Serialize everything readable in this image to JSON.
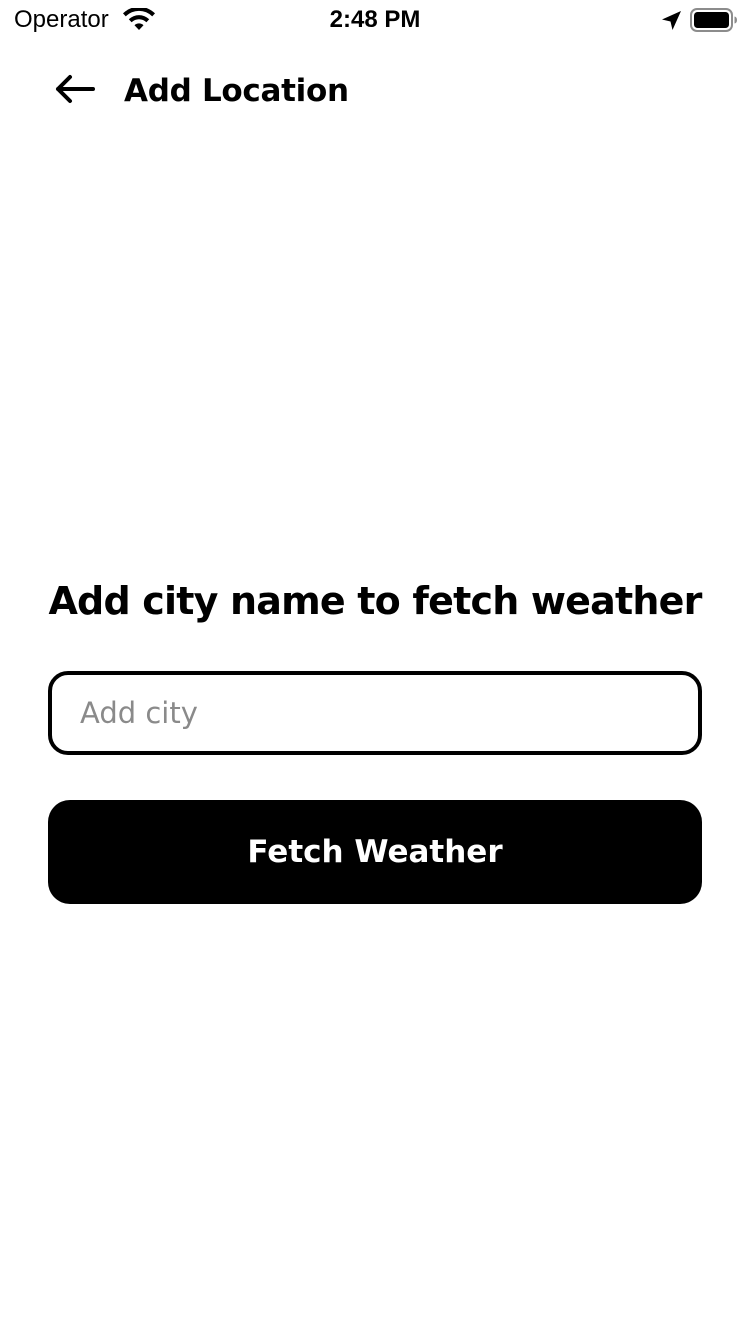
{
  "status_bar": {
    "carrier": "Operator",
    "time": "2:48 PM",
    "icons": [
      "wifi-icon",
      "location-arrow-icon",
      "battery-icon"
    ]
  },
  "header": {
    "back_icon": "arrow-left-icon",
    "title": "Add Location"
  },
  "main": {
    "heading": "Add city name to fetch weather",
    "city_input": {
      "value": "",
      "placeholder": "Add city"
    },
    "fetch_button_label": "Fetch Weather"
  },
  "colors": {
    "background": "#ffffff",
    "primary": "#000000",
    "button_text": "#ffffff",
    "placeholder": "#8a8a8a"
  }
}
